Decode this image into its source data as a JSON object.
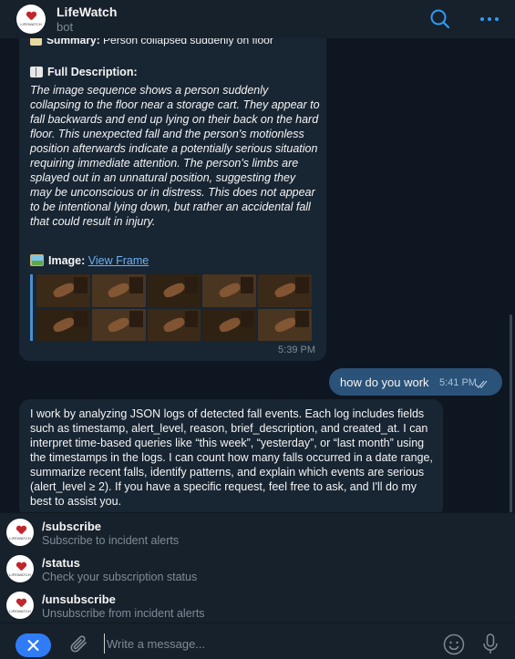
{
  "header": {
    "title": "LifeWatch",
    "subtitle": "bot",
    "avatar_text": "LIFEWATCH",
    "search_icon": "search-icon",
    "menu_icon": "more-dots-icon"
  },
  "messages": {
    "bot_alert": {
      "summary_label": "Summary:",
      "summary_text": "Person collapsed suddenly on floor",
      "full_desc_label": "Full Description:",
      "full_desc_text": "The image sequence shows a person suddenly collapsing to the floor near a storage cart. They appear to fall backwards and end up lying on their back on the hard floor. This unexpected fall and the person's motionless position afterwards indicate a potentially serious situation requiring immediate attention. The person's limbs are splayed out in an unnatural position, suggesting they may be unconscious or in distress. This does not appear to be intentional lying down, but rather an accidental fall that could result in injury.",
      "image_label": "Image:",
      "image_link": "View Frame",
      "time": "5:39 PM"
    },
    "user_message": {
      "text": "how do you work",
      "time": "5:41 PM"
    },
    "bot_reply": {
      "text": "I work by analyzing JSON logs of detected fall events. Each log includes fields such as timestamp, alert_level, reason, brief_description, and created_at. I can interpret time-based queries like “this week”, “yesterday”, or “last month” using the timestamps in the logs. I can count how many falls occurred in a date range, summarize recent falls, identify patterns, and explain which events are serious (alert_level ≥ 2). If you have a specific request, feel free to ask, and I'll do my best to assist you."
    }
  },
  "commands": [
    {
      "name": "/subscribe",
      "description": "Subscribe to incident alerts"
    },
    {
      "name": "/status",
      "description": "Check your subscription status"
    },
    {
      "name": "/unsubscribe",
      "description": "Unsubscribe from incident alerts"
    }
  ],
  "composer": {
    "placeholder": "Write a message..."
  },
  "colors": {
    "background": "#0e1621",
    "panel": "#17212b",
    "incoming_bubble": "#182533",
    "outgoing_bubble": "#2b5278",
    "accent": "#2f7cf6",
    "link": "#6ab3f3"
  }
}
